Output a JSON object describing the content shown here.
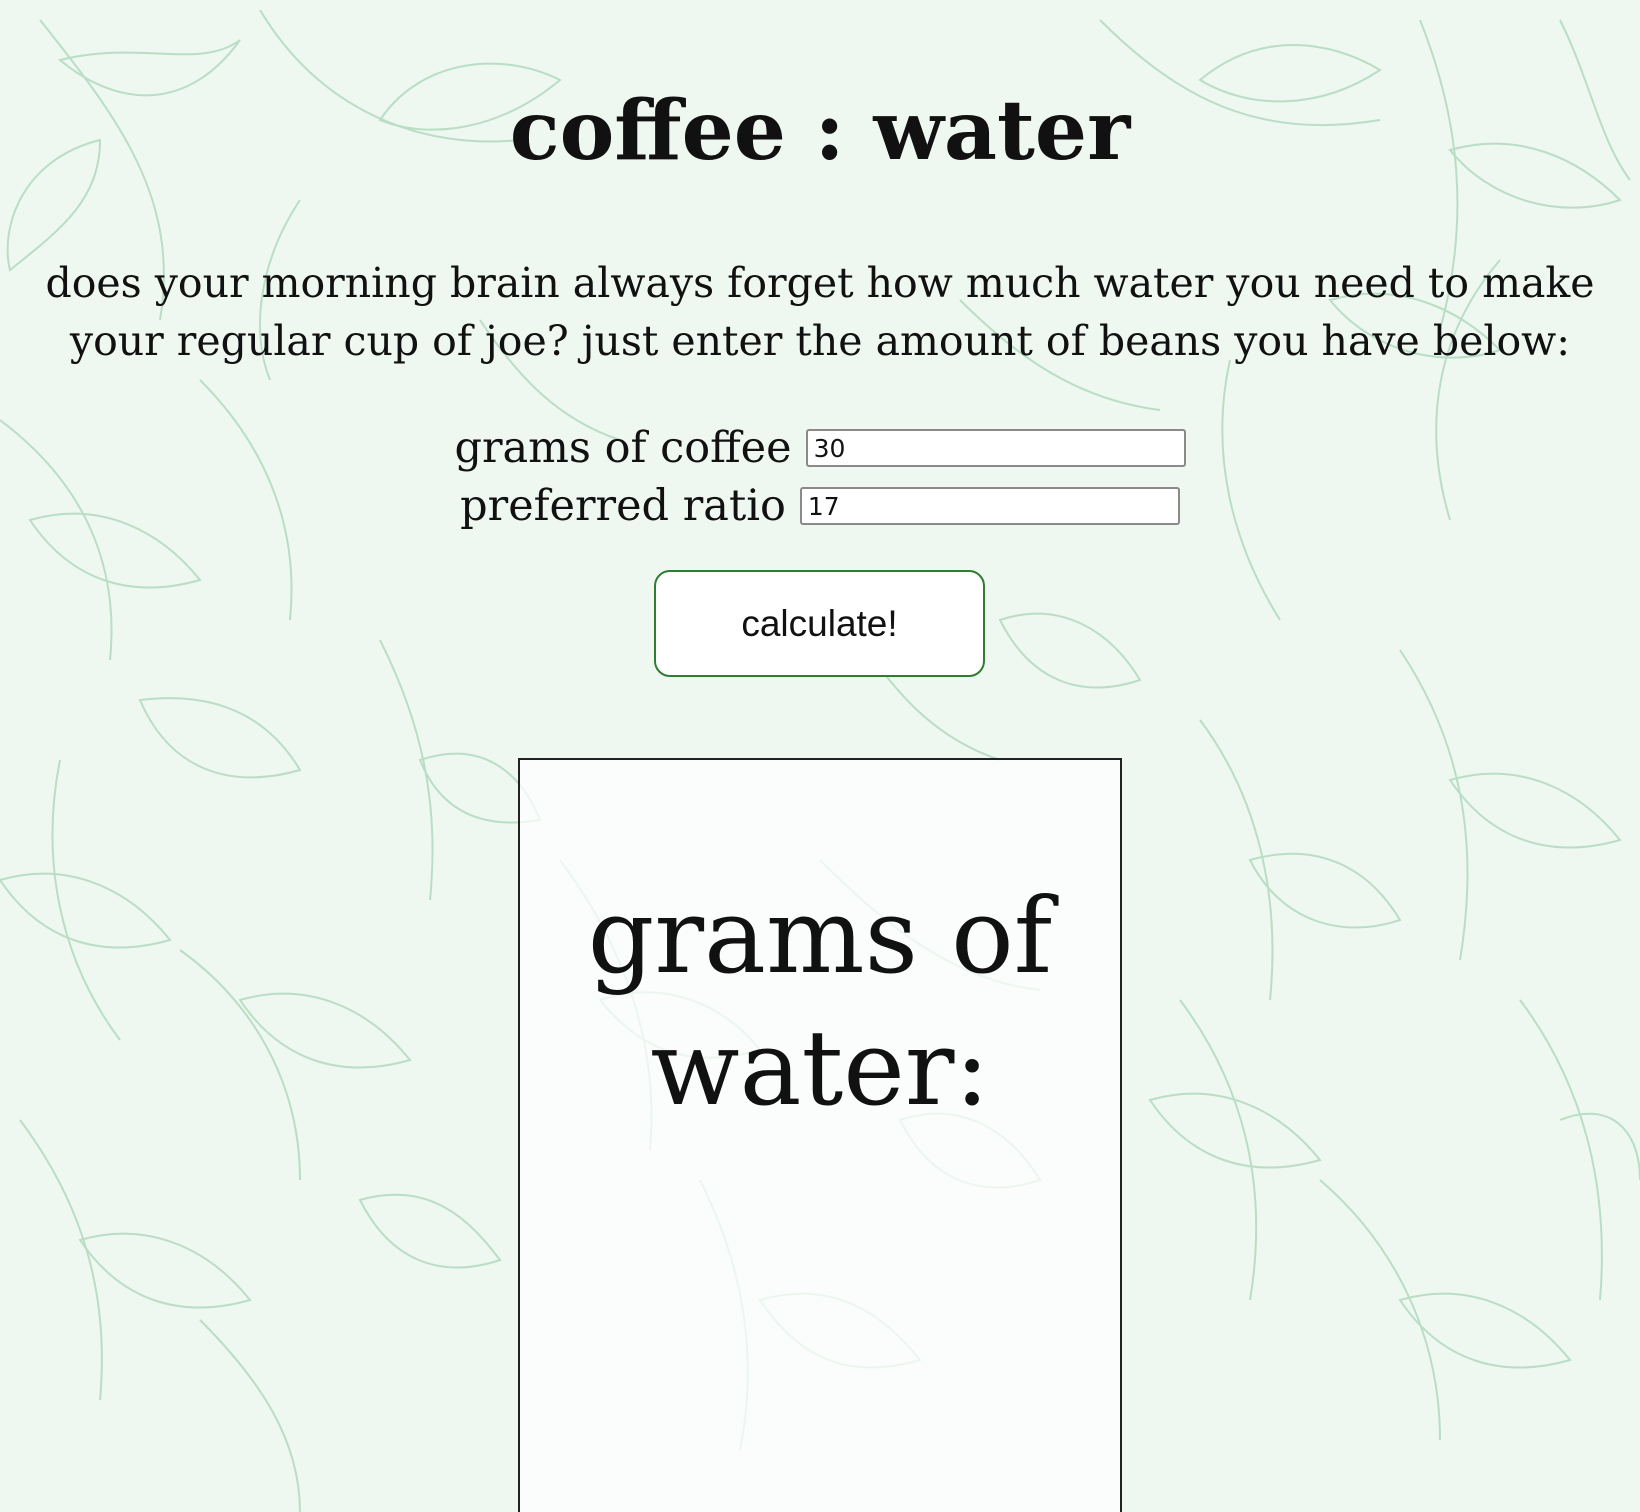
{
  "page": {
    "title": "coffee : water",
    "intro": "does your morning brain always forget how much water you need to make your regular cup of joe? just enter the amount of beans you have below:"
  },
  "form": {
    "coffee_label": "grams of coffee",
    "coffee_value": "30",
    "ratio_label": "preferred ratio",
    "ratio_value": "17",
    "button_label": "calculate!"
  },
  "result": {
    "heading": "grams of water:"
  },
  "colors": {
    "background": "#eef7f0",
    "leaf_stroke": "#7fc495",
    "button_border": "#2e7d32"
  }
}
